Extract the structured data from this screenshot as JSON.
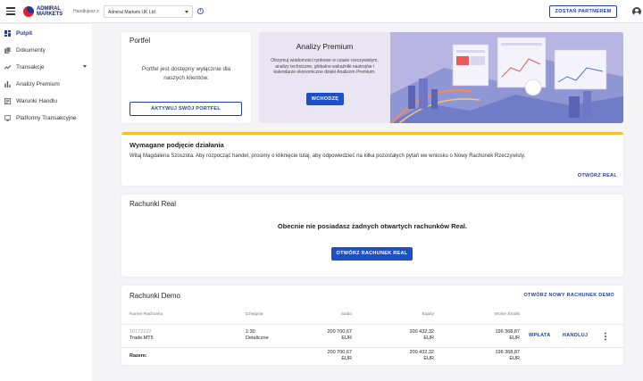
{
  "header": {
    "logo_line1": "ADMIRAL",
    "logo_line2": "MARKETS",
    "trading_with_label": "Handlujesz z",
    "entity_value": "Admiral Markets UK Ltd",
    "info_icon": "i",
    "partner_button": "ZOSTAŃ PARTNEREM"
  },
  "sidebar": {
    "items": [
      {
        "label": "Pulpit",
        "icon": "dashboard-icon"
      },
      {
        "label": "Dokumenty",
        "icon": "documents-icon"
      },
      {
        "label": "Transakcje",
        "icon": "transactions-icon"
      },
      {
        "label": "Analizy Premium",
        "icon": "bar-chart-icon"
      },
      {
        "label": "Warunki Handlu",
        "icon": "conditions-icon"
      },
      {
        "label": "Platformy Transakcyjne",
        "icon": "platforms-icon"
      }
    ]
  },
  "portfolio": {
    "title": "Portfel",
    "text": "Portfel jest dostępny wyłącznie dla naszych klientów.",
    "button": "AKTYWUJ SWÓJ PORTFEL"
  },
  "premium": {
    "title": "Analizy Premium",
    "text": "Otrzymuj wiadomości rynkowe w czasie rzeczywistym, analizy techniczne, globalne wskaźniki nastrojów i kalendarze ekonomiczne dzięki Analizom Premium.",
    "button": "WCHODZĘ"
  },
  "action": {
    "title": "Wymagane podjęcie działania",
    "text": "Witaj Magdalena Szoszota. Aby rozpocząć handel, prosimy o kliknięcie tutaj, aby odpowiedzieć na kilka pozostałych pytań we wniosku o Nowy Rachunek Rzeczywisty.",
    "link": "OTWÓRZ REAL",
    "accent": "#f2c12e"
  },
  "real": {
    "title": "Rachunki Real",
    "message": "Obecnie nie posiadasz żadnych otwartych rachunków Real.",
    "button": "OTWÓRZ RACHUNEK REAL"
  },
  "demo": {
    "title": "Rachunki Demo",
    "new_link": "OTWÓRZ NOWY RACHUNEK DEMO",
    "columns": [
      "Numer Rachunku",
      "Dźwignia",
      "Saldo",
      "Equity",
      "Wolne Środki"
    ],
    "row": {
      "account_number": "10172222",
      "platform": "Trade.MT5",
      "leverage": "1:30",
      "leverage_type": "Detaliczne",
      "balance": "200 700,67",
      "balance_cur": "EUR",
      "equity": "200 432,32",
      "equity_cur": "EUR",
      "free": "196 368,87",
      "free_cur": "EUR",
      "deposit": "WPŁATA",
      "trade": "HANDLUJ"
    },
    "total": {
      "label": "Razem:",
      "balance": "200 700,67",
      "balance_cur": "EUR",
      "equity": "200 432,32",
      "equity_cur": "EUR",
      "free": "196 368,87",
      "free_cur": "EUR"
    }
  },
  "colors": {
    "brand_blue": "#1c3fa8",
    "button_blue": "#1c4fc8",
    "logo_red": "#e3222c"
  }
}
